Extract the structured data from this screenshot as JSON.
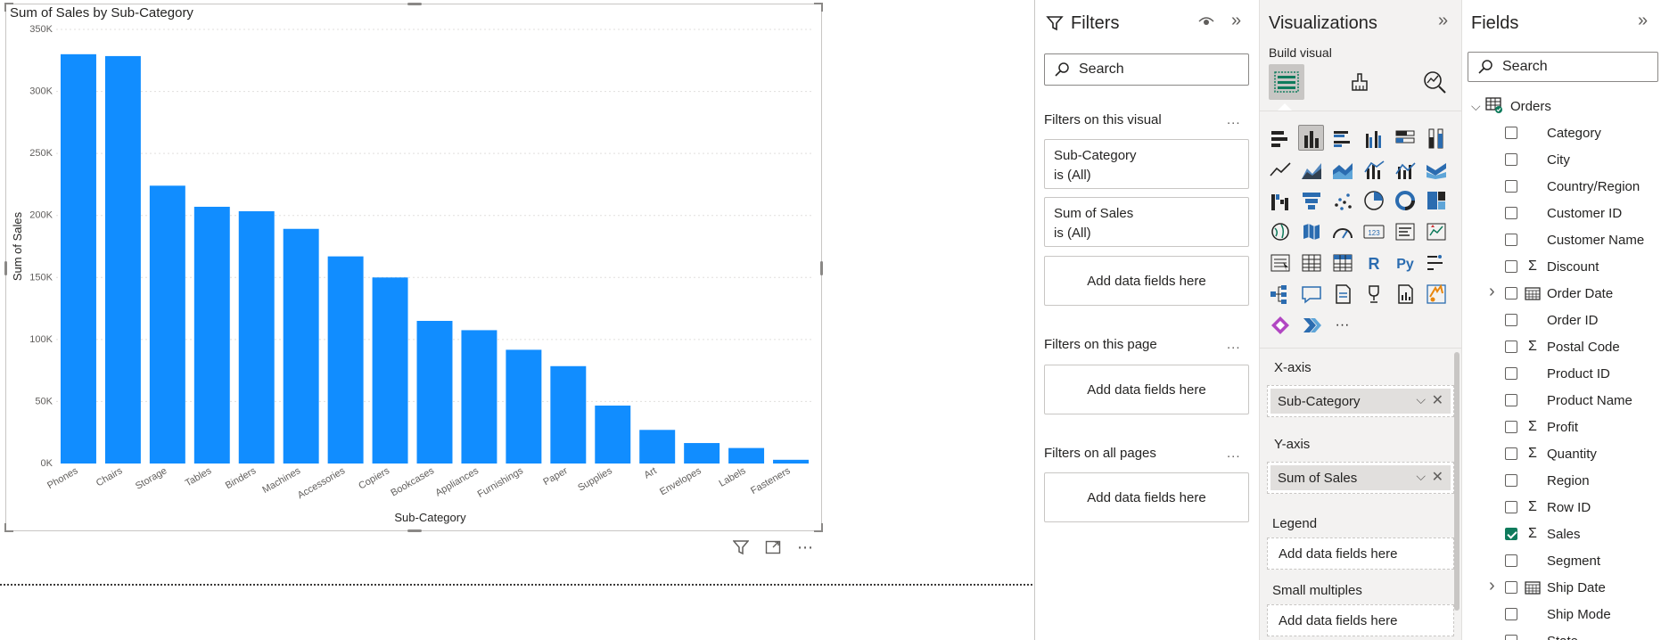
{
  "chart_data": {
    "type": "bar",
    "title": "Sum of Sales by Sub-Category",
    "xlabel": "Sub-Category",
    "ylabel": "Sum of Sales",
    "categories": [
      "Phones",
      "Chairs",
      "Storage",
      "Tables",
      "Binders",
      "Machines",
      "Accessories",
      "Copiers",
      "Bookcases",
      "Appliances",
      "Furnishings",
      "Paper",
      "Supplies",
      "Art",
      "Envelopes",
      "Labels",
      "Fasteners"
    ],
    "values": [
      330000,
      328500,
      224000,
      207000,
      203400,
      189200,
      167000,
      150000,
      115000,
      107500,
      91700,
      78500,
      46700,
      27100,
      16500,
      12500,
      3000
    ],
    "ylim": [
      0,
      350000
    ],
    "yticks": [
      "0K",
      "50K",
      "100K",
      "150K",
      "200K",
      "250K",
      "300K",
      "350K"
    ],
    "bar_color": "#118dff",
    "grid": true,
    "legend": "none"
  },
  "visual_header": {
    "filter_icon": "filter-icon",
    "focus_icon": "focus-mode-icon",
    "more_icon": "more-options-icon",
    "more_label": "⋯"
  },
  "filters": {
    "title": "Filters",
    "collapse_glyph": "»",
    "search_placeholder": "Search",
    "on_visual_label": "Filters on this visual",
    "on_page_label": "Filters on this page",
    "on_all_label": "Filters on all pages",
    "more_label": "...",
    "visual_cards": [
      {
        "field": "Sub-Category",
        "state": "is (All)"
      },
      {
        "field": "Sum of Sales",
        "state": "is (All)"
      }
    ],
    "add_fields": "Add data fields here"
  },
  "visualizations": {
    "title": "Visualizations",
    "collapse_glyph": "»",
    "build_visual": "Build visual",
    "more_visuals": "···",
    "r_label": "R",
    "py_label": "Py",
    "card_label": "123",
    "wells": {
      "x_axis_label": "X-axis",
      "x_axis_field": "Sub-Category",
      "y_axis_label": "Y-axis",
      "y_axis_field": "Sum of Sales",
      "legend_label": "Legend",
      "small_multiples_label": "Small multiples",
      "empty": "Add data fields here",
      "chevron": "⌵",
      "remove": "✕"
    }
  },
  "fields": {
    "title": "Fields",
    "collapse_glyph": "»",
    "search_placeholder": "Search",
    "table_name": "Orders",
    "items": [
      {
        "name": "Category",
        "icon": "",
        "checked": false,
        "expandable": false
      },
      {
        "name": "City",
        "icon": "",
        "checked": false,
        "expandable": false
      },
      {
        "name": "Country/Region",
        "icon": "",
        "checked": false,
        "expandable": false
      },
      {
        "name": "Customer ID",
        "icon": "",
        "checked": false,
        "expandable": false
      },
      {
        "name": "Customer Name",
        "icon": "",
        "checked": false,
        "expandable": false
      },
      {
        "name": "Discount",
        "icon": "sigma",
        "checked": false,
        "expandable": false
      },
      {
        "name": "Order Date",
        "icon": "calendar",
        "checked": false,
        "expandable": true
      },
      {
        "name": "Order ID",
        "icon": "",
        "checked": false,
        "expandable": false
      },
      {
        "name": "Postal Code",
        "icon": "sigma",
        "checked": false,
        "expandable": false
      },
      {
        "name": "Product ID",
        "icon": "",
        "checked": false,
        "expandable": false
      },
      {
        "name": "Product Name",
        "icon": "",
        "checked": false,
        "expandable": false
      },
      {
        "name": "Profit",
        "icon": "sigma",
        "checked": false,
        "expandable": false
      },
      {
        "name": "Quantity",
        "icon": "sigma",
        "checked": false,
        "expandable": false
      },
      {
        "name": "Region",
        "icon": "",
        "checked": false,
        "expandable": false
      },
      {
        "name": "Row ID",
        "icon": "sigma",
        "checked": false,
        "expandable": false
      },
      {
        "name": "Sales",
        "icon": "sigma",
        "checked": true,
        "expandable": false
      },
      {
        "name": "Segment",
        "icon": "",
        "checked": false,
        "expandable": false
      },
      {
        "name": "Ship Date",
        "icon": "calendar",
        "checked": false,
        "expandable": true
      },
      {
        "name": "Ship Mode",
        "icon": "",
        "checked": false,
        "expandable": false
      },
      {
        "name": "State",
        "icon": "",
        "checked": false,
        "expandable": false
      }
    ]
  }
}
